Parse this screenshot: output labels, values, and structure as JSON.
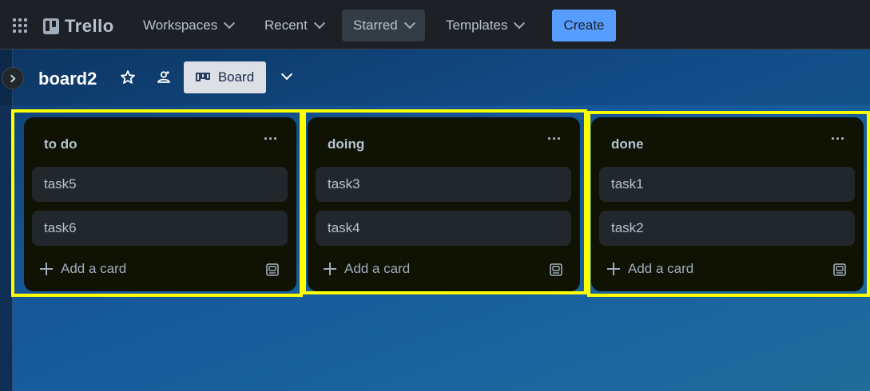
{
  "topbar": {
    "logo_text": "Trello",
    "nav": [
      {
        "label": "Workspaces"
      },
      {
        "label": "Recent"
      },
      {
        "label": "Starred"
      },
      {
        "label": "Templates"
      }
    ],
    "create_label": "Create"
  },
  "board": {
    "title": "board2",
    "view_label": "Board",
    "lists": [
      {
        "title": "to do",
        "cards": [
          "task5",
          "task6"
        ],
        "add_label": "Add a card"
      },
      {
        "title": "doing",
        "cards": [
          "task3",
          "task4"
        ],
        "add_label": "Add a card"
      },
      {
        "title": "done",
        "cards": [
          "task1",
          "task2"
        ],
        "add_label": "Add a card"
      }
    ]
  },
  "colors": {
    "accent": "#579dff",
    "highlight": "#ffff00",
    "list_bg": "#101204",
    "card_bg": "#22272b"
  },
  "icons": [
    "apps-grid-icon",
    "trello-logo-icon",
    "chevron-down-icon",
    "chevron-right-icon",
    "star-icon",
    "workspace-visibility-icon",
    "board-view-icon",
    "more-icon",
    "plus-icon",
    "card-template-icon"
  ]
}
